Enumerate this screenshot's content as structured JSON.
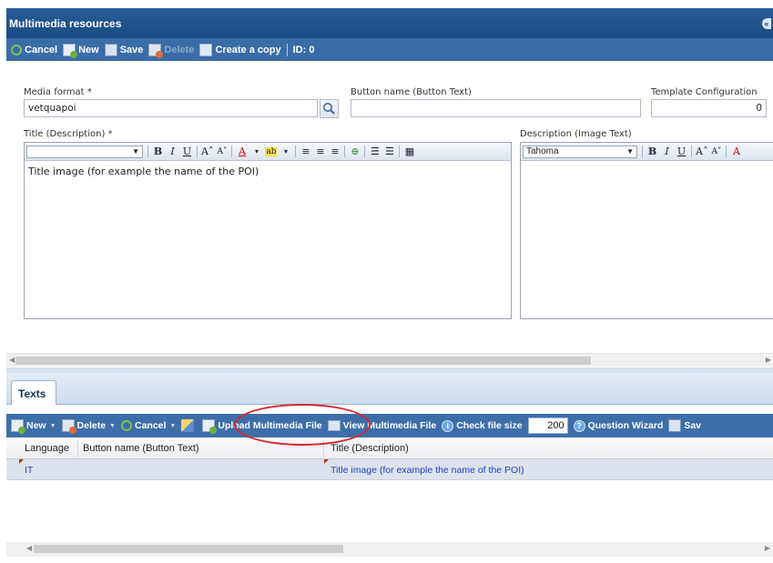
{
  "window": {
    "title": "Multimedia resources"
  },
  "toolbar": {
    "cancel": "Cancel",
    "new": "New",
    "save": "Save",
    "delete": "Delete",
    "create_copy": "Create a copy",
    "id": "ID: 0"
  },
  "form": {
    "media_format_label": "Media format *",
    "media_format_value": "vetquapoi",
    "button_name_label": "Button name (Button Text)",
    "button_name_value": "",
    "template_config_label": "Template Configuration",
    "template_config_value": "0",
    "title_label": "Title (Description) *",
    "title_text": "Title image (for example the name of the POI)",
    "description_label": "Description (Image Text)",
    "description_font": "Tahoma"
  },
  "tabs": [
    "Texts"
  ],
  "grid_toolbar": {
    "new": "New",
    "delete": "Delete",
    "cancel": "Cancel",
    "upload": "Upload Multimedia File",
    "view": "View Multimedia File",
    "check_size": "Check file size",
    "size_value": "200",
    "wizard": "Question Wizard",
    "save": "Sav"
  },
  "grid": {
    "columns": [
      "Language",
      "Button name (Button Text)",
      "Title (Description)"
    ],
    "rows": [
      {
        "language": "IT",
        "button_name": "",
        "title": "Title image (for example the name of the POI)"
      }
    ]
  },
  "colors": {
    "header": "#194a84",
    "toolbar": "#3a6ca7",
    "highlight": "#d8262c"
  }
}
